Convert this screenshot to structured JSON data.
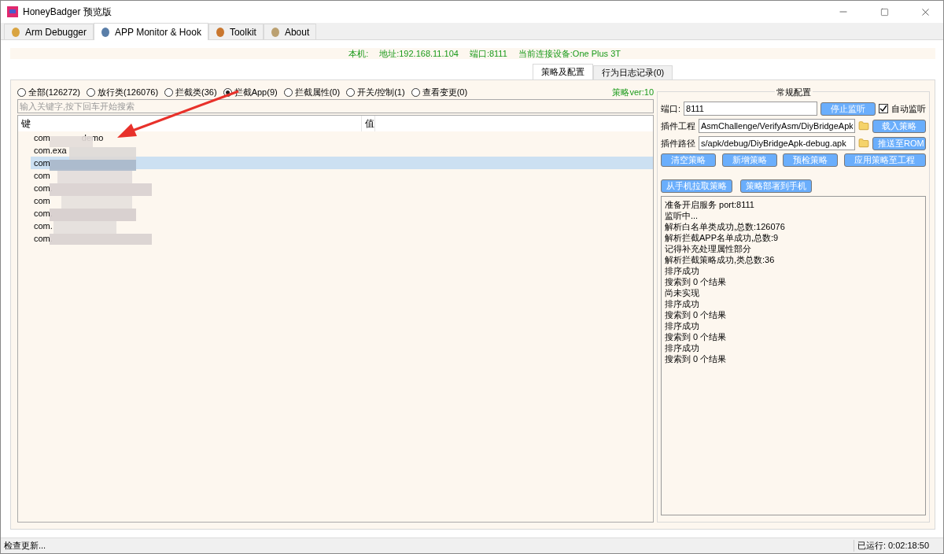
{
  "window": {
    "title": "HoneyBadger 预览版"
  },
  "main_tabs": [
    {
      "label": "Arm Debugger",
      "selected": false
    },
    {
      "label": "APP Monitor & Hook",
      "selected": true
    },
    {
      "label": "Toolkit",
      "selected": false
    },
    {
      "label": "About",
      "selected": false
    }
  ],
  "info_bar": [
    {
      "label": "本机:"
    },
    {
      "label": "地址:192.168.11.104"
    },
    {
      "label": "端口:8111"
    },
    {
      "label": "当前连接设备:One Plus 3T"
    }
  ],
  "sub_tabs": [
    {
      "label": "策略及配置",
      "selected": true
    },
    {
      "label": "行为日志记录(0)",
      "selected": false
    }
  ],
  "filters": [
    {
      "label": "全部(126272)",
      "selected": false
    },
    {
      "label": "放行类(126076)",
      "selected": false
    },
    {
      "label": "拦截类(36)",
      "selected": false
    },
    {
      "label": "拦截App(9)",
      "selected": true
    },
    {
      "label": "拦截属性(0)",
      "selected": false
    },
    {
      "label": "开关/控制(1)",
      "selected": false
    },
    {
      "label": "查看变更(0)",
      "selected": false
    }
  ],
  "version": "策略ver:10",
  "search": {
    "placeholder": "输入关键字,按下回车开始搜索"
  },
  "table": {
    "columns": [
      "键",
      "值"
    ],
    "rows": [
      {
        "key": "com",
        "key_tail": "demo",
        "selected": false
      },
      {
        "key": "com.exa",
        "selected": false
      },
      {
        "key": "com",
        "selected": true
      },
      {
        "key": "com",
        "selected": false
      },
      {
        "key": "com.",
        "selected": false
      },
      {
        "key": "com",
        "selected": false
      },
      {
        "key": "com.",
        "selected": false
      },
      {
        "key": "com.",
        "selected": false
      },
      {
        "key": "com.",
        "selected": false
      }
    ]
  },
  "config": {
    "title": "常规配置",
    "port": {
      "label": "端口:",
      "value": "8111"
    },
    "stop_button": "停止监听",
    "auto_listen": {
      "label": "自动监听",
      "checked": true
    },
    "project": {
      "label": "插件工程",
      "value": "AsmChallenge/VerifyAsm/DiyBridgeApk"
    },
    "load_button": "载入策略",
    "path": {
      "label": "插件路径",
      "value": "s/apk/debug/DiyBridgeApk-debug.apk"
    },
    "push_button": "推送至ROM",
    "action_buttons": [
      "清空策略",
      "新增策略",
      "预检策略",
      "应用策略至工程"
    ],
    "phone_buttons": [
      "从手机拉取策略",
      "策略部署到手机"
    ],
    "log": [
      "准备开启服务 port:8111",
      "监听中...",
      "解析白名单类成功,总数:126076",
      "解析拦截APP名单成功,总数:9",
      "记得补充处理属性部分",
      "解析拦截策略成功,类总数:36",
      "排序成功",
      "搜索到 0 个结果",
      "尚未实现",
      "排序成功",
      "搜索到 0 个结果",
      "排序成功",
      "搜索到 0 个结果",
      "排序成功",
      "搜索到 0 个结果"
    ]
  },
  "status_bar": {
    "left": "检查更新...",
    "right": "已运行: 0:02:18:50"
  }
}
